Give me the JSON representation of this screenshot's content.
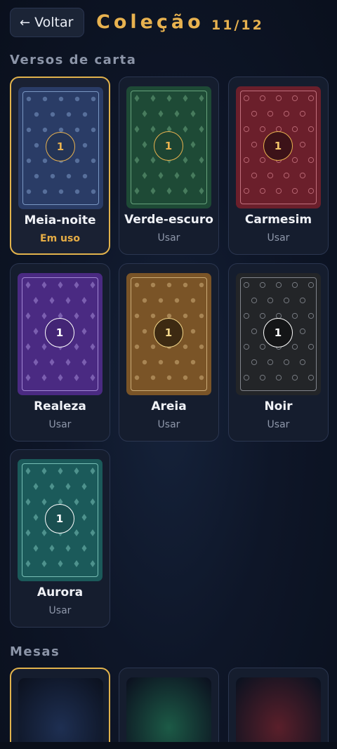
{
  "header": {
    "back_label": "Voltar",
    "back_arrow": "←",
    "title": "Coleção",
    "count": "11/12"
  },
  "sections": {
    "card_backs_title": "Versos de carta",
    "tables_title": "Mesas"
  },
  "card_backs": [
    {
      "name": "Meia-noite",
      "action": "Em uso",
      "selected": true,
      "medallion": "1",
      "pattern": "dot",
      "base": "#2a3c66",
      "accent": "#8eaedb",
      "medal_bg": "#243456",
      "medal_fg": "#e8b24f",
      "medal_border": "#e8b24f"
    },
    {
      "name": "Verde-escuro",
      "action": "Usar",
      "selected": false,
      "medallion": "1",
      "pattern": "diamond",
      "base": "#1e4a36",
      "accent": "#79b88f",
      "medal_bg": "#1d4432",
      "medal_fg": "#e8b24f",
      "medal_border": "#e8b24f"
    },
    {
      "name": "Carmesim",
      "action": "Usar",
      "selected": false,
      "medallion": "1",
      "pattern": "ring",
      "base": "#6b1f2b",
      "accent": "#d78592",
      "medal_bg": "#3c1218",
      "medal_fg": "#f2c46a",
      "medal_border": "#e8b24f"
    },
    {
      "name": "Realeza",
      "action": "Usar",
      "selected": false,
      "medallion": "1",
      "pattern": "diamond",
      "base": "#4a2a82",
      "accent": "#b8a0e8",
      "medal_bg": "#432575",
      "medal_fg": "#ffffff",
      "medal_border": "#ffffff"
    },
    {
      "name": "Areia",
      "action": "Usar",
      "selected": false,
      "medallion": "1",
      "pattern": "dot",
      "base": "#7a5427",
      "accent": "#e0c08c",
      "medal_bg": "#3d2a12",
      "medal_fg": "#f2d68a",
      "medal_border": "#f2d68a"
    },
    {
      "name": "Noir",
      "action": "Usar",
      "selected": false,
      "medallion": "1",
      "pattern": "ring",
      "base": "#232528",
      "accent": "#9a9ea6",
      "medal_bg": "#141517",
      "medal_fg": "#ffffff",
      "medal_border": "#ffffff"
    },
    {
      "name": "Aurora",
      "action": "Usar",
      "selected": false,
      "medallion": "1",
      "pattern": "diamond",
      "base": "#1b5a5a",
      "accent": "#8fd8cc",
      "medal_bg": "#1a4f50",
      "medal_fg": "#ffffff",
      "medal_border": "#ffffff"
    }
  ],
  "tables": [
    {
      "selected": true,
      "felt": "#1e2f52"
    },
    {
      "selected": false,
      "felt": "#1c5a46"
    },
    {
      "selected": false,
      "felt": "#5a1f2a"
    }
  ]
}
